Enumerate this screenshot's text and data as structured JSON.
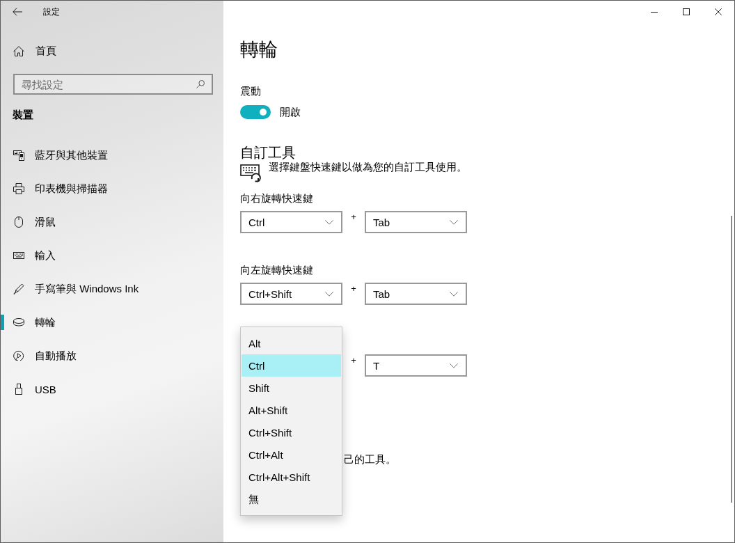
{
  "window": {
    "title": "設定"
  },
  "sidebar": {
    "home": "首頁",
    "search": {
      "placeholder": "尋找設定"
    },
    "section": "裝置",
    "items": [
      {
        "label": "藍牙與其他裝置",
        "selected": false
      },
      {
        "label": "印表機與掃描器",
        "selected": false
      },
      {
        "label": "滑鼠",
        "selected": false
      },
      {
        "label": "輸入",
        "selected": false
      },
      {
        "label": "手寫筆與 Windows Ink",
        "selected": false
      },
      {
        "label": "轉輪",
        "selected": true
      },
      {
        "label": "自動播放",
        "selected": false
      },
      {
        "label": "USB",
        "selected": false
      }
    ]
  },
  "page": {
    "title": "轉輪",
    "vibration": {
      "label": "震動",
      "toggle": {
        "on": true,
        "label": "開啟"
      }
    },
    "custom_tools": {
      "heading": "自訂工具",
      "description": "選擇鍵盤快速鍵以做為您的自訂工具使用。",
      "shortcuts": [
        {
          "label": "向右旋轉快速鍵",
          "modifier": "Ctrl",
          "plus": "+",
          "key": "Tab"
        },
        {
          "label": "向左旋轉快速鍵",
          "modifier": "Ctrl+Shift",
          "plus": "+",
          "key": "Tab"
        },
        {
          "plus": "+",
          "key": "T",
          "menu": {
            "options": [
              {
                "label": "Alt",
                "selected": false
              },
              {
                "label": "Ctrl",
                "selected": true
              },
              {
                "label": "Shift",
                "selected": false
              },
              {
                "label": "Alt+Shift",
                "selected": false
              },
              {
                "label": "Ctrl+Shift",
                "selected": false
              },
              {
                "label": "Ctrl+Alt",
                "selected": false
              },
              {
                "label": "Ctrl+Alt+Shift",
                "selected": false
              },
              {
                "label": "無",
                "selected": false
              }
            ]
          }
        }
      ]
    },
    "partial_text": "己的工具。"
  }
}
